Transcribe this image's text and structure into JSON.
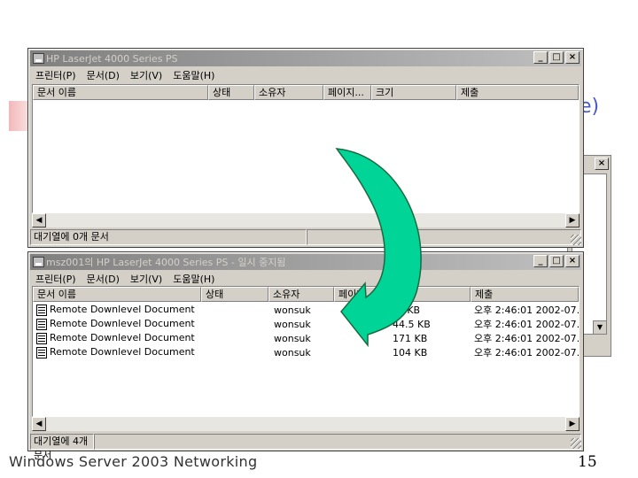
{
  "slide": {
    "title_fragment": "e)",
    "footer": "Windows  Server 2003 Networking",
    "page_number": "15"
  },
  "window_top": {
    "title": "HP LaserJet 4000 Series PS",
    "menus": [
      "프린터(P)",
      "문서(D)",
      "보기(V)",
      "도움말(H)"
    ],
    "columns": [
      "문서 이름",
      "상태",
      "소유자",
      "페이지...",
      "크기",
      "제출"
    ],
    "status": "대기열에 0개 문서"
  },
  "window_bottom": {
    "title": "msz001의 HP LaserJet 4000 Series PS - 일시 중지됨",
    "menus": [
      "프린터(P)",
      "문서(D)",
      "보기(V)",
      "도움말(H)"
    ],
    "columns": [
      "문서 이름",
      "상태",
      "소유자",
      "페이지",
      "크기",
      "제출"
    ],
    "rows": [
      {
        "name": "Remote Downlevel Document",
        "status": "",
        "owner": "wonsuk",
        "pages": "",
        "size": "?4 KB",
        "submitted": "오후 2:46:01  2002-07..."
      },
      {
        "name": "Remote Downlevel Document",
        "status": "",
        "owner": "wonsuk",
        "pages": "",
        "size": "44.5 KB",
        "submitted": "오후 2:46:01  2002-07..."
      },
      {
        "name": "Remote Downlevel Document",
        "status": "",
        "owner": "wonsuk",
        "pages": "",
        "size": "171 KB",
        "submitted": "오후 2:46:01  2002-07..."
      },
      {
        "name": "Remote Downlevel Document",
        "status": "",
        "owner": "wonsuk",
        "pages": "",
        "size": "104 KB",
        "submitted": "오후 2:46:01  2002-07..."
      }
    ],
    "status": "대기열에 4개 문서"
  },
  "icons": {
    "minimize": "_",
    "maximize": "□",
    "close": "×",
    "scroll_left": "◀",
    "scroll_right": "▶",
    "scroll_down": "▼"
  },
  "colors": {
    "arrow_fill": "#00d496",
    "arrow_stroke": "#1a6a40",
    "titlebar_active": "#0a246a"
  }
}
